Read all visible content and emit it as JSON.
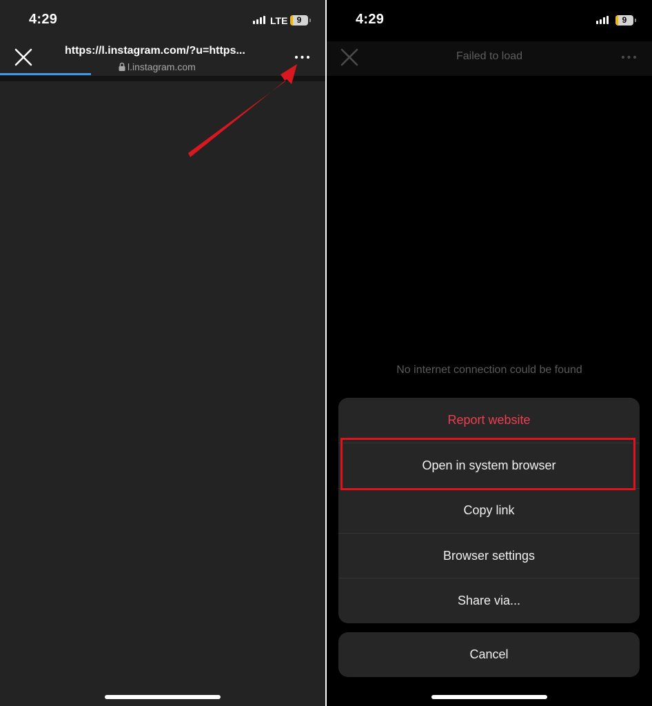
{
  "left_panel": {
    "status_bar": {
      "time": "4:29",
      "network": "LTE",
      "battery_level": "9"
    },
    "nav": {
      "url_title": "https://l.instagram.com/?u=https...",
      "domain": "l.instagram.com"
    },
    "icons": {
      "close": "close-icon",
      "more": "more-icon",
      "lock": "lock-icon"
    }
  },
  "right_panel": {
    "status_bar": {
      "time": "4:29",
      "battery_level": "9"
    },
    "nav": {
      "title": "Failed to load"
    },
    "message": "No internet connection could be found",
    "sheet": {
      "items": [
        {
          "label": "Report website"
        },
        {
          "label": "Open in system browser"
        },
        {
          "label": "Copy link"
        },
        {
          "label": "Browser settings"
        },
        {
          "label": "Share via..."
        }
      ],
      "cancel_label": "Cancel"
    }
  },
  "colors": {
    "left_background": "#232323",
    "right_background": "#000000",
    "sheet_background": "#262626",
    "destructive": "#ee3e50",
    "progress_accent": "#3e9ae8",
    "annotation_red": "#e0131d"
  }
}
